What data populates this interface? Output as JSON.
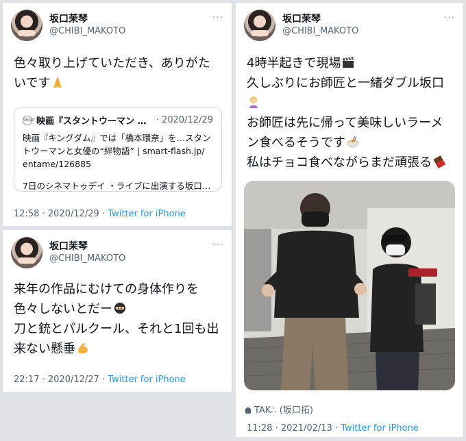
{
  "tweets": [
    {
      "name": "坂口茉琴",
      "handle": "@CHIBI_MAKOTO",
      "text_line1": "色々取り上げていただき、ありがた",
      "text_line2": "いです",
      "emoji": "folded-hands",
      "link_card": {
        "title": "映画『スタントウーマン ハリ…",
        "date": "· 2020/12/29",
        "body_line1": "映画『キングダム』では「橋本環奈」を…スタン",
        "body_line2": "トウーマンと女優の“絆物語”  |  smart-flash.jp/",
        "body_line3": "entame/126885",
        "excerpt": "7日のシネマトゥデイ ・ライブに出演する坂口…"
      },
      "time": "12:58",
      "date": "2020/12/29",
      "source": "Twitter for iPhone"
    },
    {
      "name": "坂口茉琴",
      "handle": "@CHIBI_MAKOTO",
      "text_line1": "来年の作品にむけての身体作りを",
      "text_line2": "色々しないとだー",
      "text_line3": "刀と銃とパルクール、それと1回も出",
      "text_line4": "来ない懸垂",
      "emoji_a": "ninja",
      "emoji_b": "flexed-biceps",
      "time": "22:17",
      "date": "2020/12/27",
      "source": "Twitter for iPhone"
    },
    {
      "name": "坂口茉琴",
      "handle": "@CHIBI_MAKOTO",
      "text_line1": "4時半起きで現場",
      "text_line2": "久しぶりにお師匠と一緒ダブル坂口",
      "text_line3": "お師匠は先に帰って美味しいラーメ",
      "text_line4": "ン食べるそうです",
      "text_line5": "私はチョコ食べながらまだ頑張る",
      "emoji_a": "clapper-board",
      "emoji_b": "woman-supervillain",
      "emoji_c": "ramen-bowl",
      "emoji_d": "chocolate-bar",
      "tagged": "TAK∴ (坂口拓)",
      "time": "11:28",
      "date": "2021/02/13",
      "source": "Twitter for iPhone"
    }
  ],
  "sep": " · ",
  "more_glyph": "···",
  "colors": {
    "link_blue": "#1d9bf0",
    "muted": "#536471",
    "text": "#0f1419",
    "border": "#cfd9de"
  }
}
